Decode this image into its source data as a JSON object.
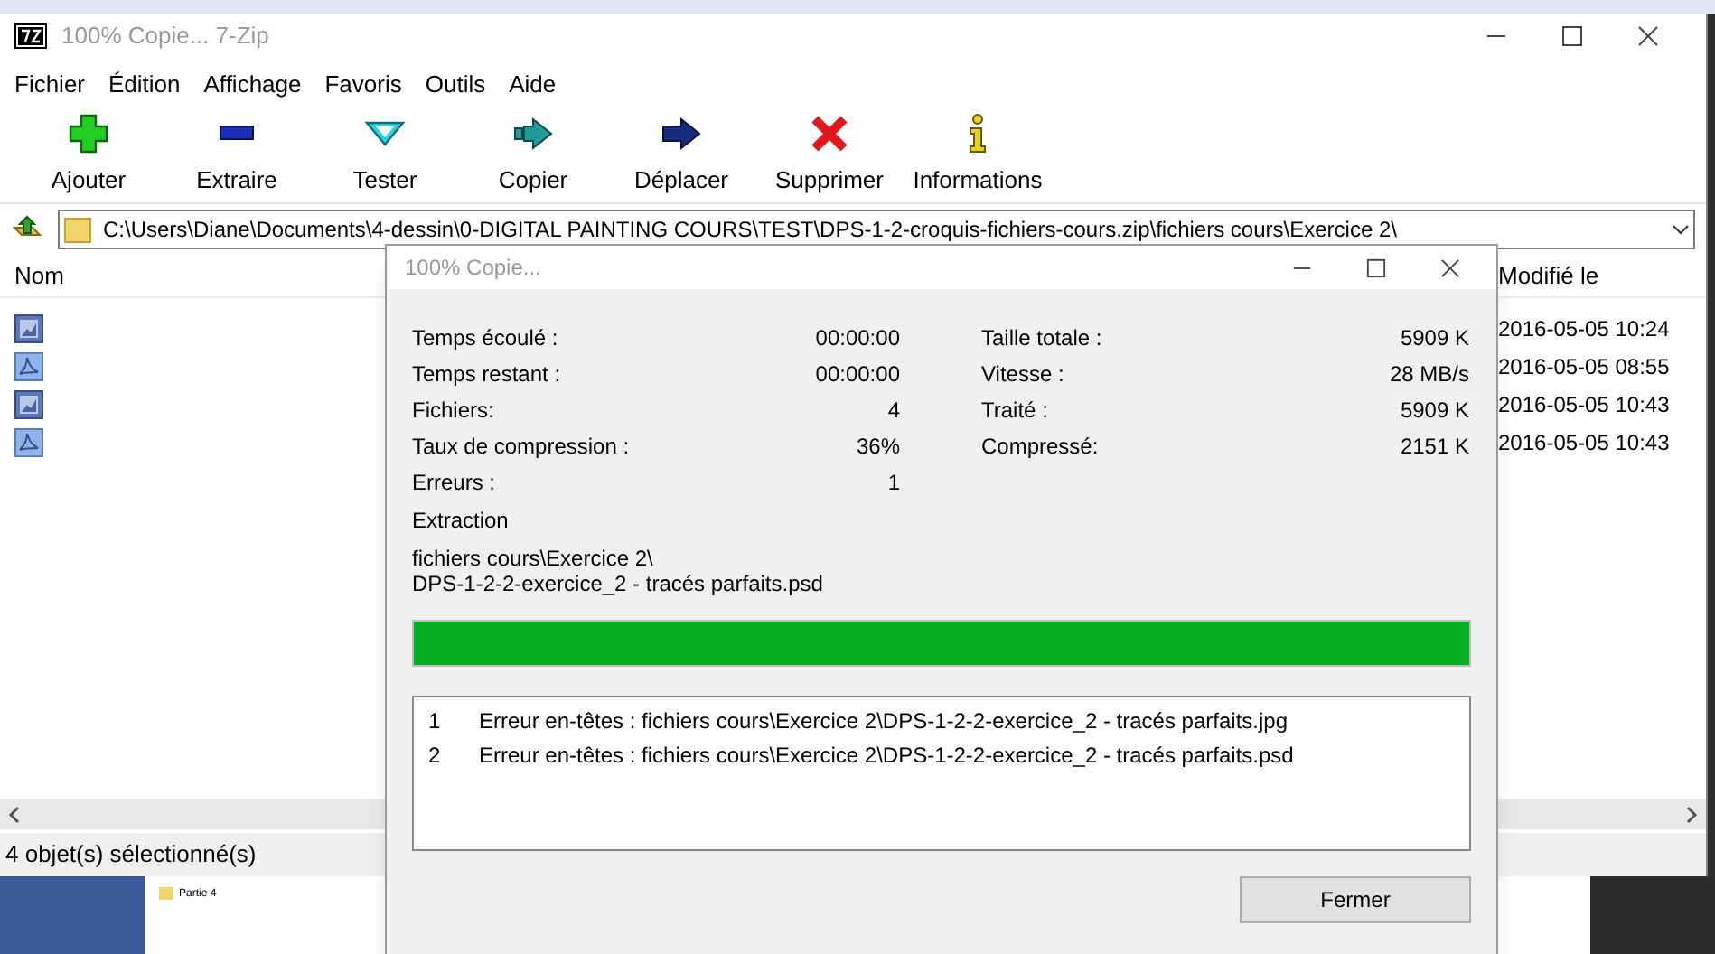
{
  "window": {
    "title": "100% Copie... 7-Zip"
  },
  "menu": [
    "Fichier",
    "Édition",
    "Affichage",
    "Favoris",
    "Outils",
    "Aide"
  ],
  "toolbar": [
    {
      "kind": "add",
      "label": "Ajouter"
    },
    {
      "kind": "extract",
      "label": "Extraire"
    },
    {
      "kind": "test",
      "label": "Tester"
    },
    {
      "kind": "copy",
      "label": "Copier"
    },
    {
      "kind": "move",
      "label": "Déplacer"
    },
    {
      "kind": "delete",
      "label": "Supprimer"
    },
    {
      "kind": "info",
      "label": "Informations"
    }
  ],
  "address": "C:\\Users\\Diane\\Documents\\4-dessin\\0-DIGITAL PAINTING COURS\\TEST\\DPS-1-2-croquis-fichiers-cours.zip\\fichiers cours\\Exercice 2\\",
  "columns": [
    "Nom",
    "Modifié le"
  ],
  "rows": [
    {
      "kind": "image",
      "modified": "2016-05-05 10:24"
    },
    {
      "kind": "pdf",
      "modified": "2016-05-05 08:55"
    },
    {
      "kind": "image",
      "modified": "2016-05-05 10:43"
    },
    {
      "kind": "pdf",
      "modified": "2016-05-05 10:43"
    }
  ],
  "status_bar": "4 objet(s) sélectionné(s)",
  "desktop": {
    "label": "Partie 4"
  },
  "dialog": {
    "title": "100% Copie...",
    "left_stats": [
      {
        "label": "Temps écoulé :",
        "value": "00:00:00"
      },
      {
        "label": "Temps restant :",
        "value": "00:00:00"
      },
      {
        "label": "Fichiers:",
        "value": "4"
      },
      {
        "label": "Taux de compression :",
        "value": "36%"
      },
      {
        "label": "Erreurs :",
        "value": "1"
      }
    ],
    "right_stats": [
      {
        "label": "Taille totale :",
        "value": "5909 K"
      },
      {
        "label": "Vitesse :",
        "value": "28 MB/s"
      },
      {
        "label": "Traité :",
        "value": "5909 K"
      },
      {
        "label": "Compressé:",
        "value": "2151 K"
      }
    ],
    "operation": "Extraction",
    "current_path": "fichiers cours\\Exercice 2\\",
    "current_file": "DPS-1-2-2-exercice_2 - tracés parfaits.psd",
    "progress": {
      "level": 1
    },
    "errors": [
      {
        "number": "1",
        "message": "Erreur en-têtes : fichiers cours\\Exercice 2\\DPS-1-2-2-exercice_2 - tracés parfaits.jpg"
      },
      {
        "number": "2",
        "message": "Erreur en-têtes : fichiers cours\\Exercice 2\\DPS-1-2-2-exercice_2 - tracés parfaits.psd"
      }
    ],
    "close_button": "Fermer"
  }
}
